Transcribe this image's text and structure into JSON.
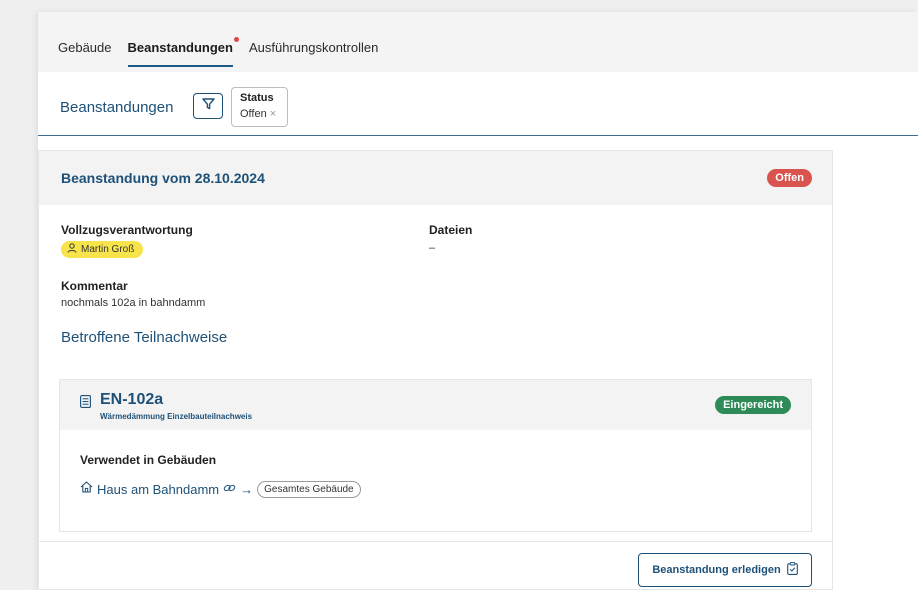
{
  "tabs": [
    {
      "label": "Gebäude",
      "active": false,
      "dot": false
    },
    {
      "label": "Beanstandungen",
      "active": true,
      "dot": true
    },
    {
      "label": "Ausführungskontrollen",
      "active": false,
      "dot": false
    }
  ],
  "filter": {
    "title": "Beanstandungen",
    "chip_label": "Status",
    "chip_value": "Offen",
    "chip_remove": "×"
  },
  "card": {
    "title": "Beanstandung vom 28.10.2024",
    "status": "Offen",
    "responsibility_label": "Vollzugsverantwortung",
    "responsible_person": "Martin Groß",
    "files_label": "Dateien",
    "files_value": "–",
    "comment_label": "Kommentar",
    "comment_value": "nochmals 102a in bahndamm",
    "affected_title": "Betroffene Teilnachweise",
    "proof": {
      "code": "EN-102a",
      "description": "Wärmedämmung Einzelbauteilnachweis",
      "status": "Eingereicht",
      "used_in_label": "Verwendet in Gebäuden",
      "building": "Haus am Bahndamm",
      "arrow": "→",
      "scope": "Gesamtes Gebäude"
    },
    "action_label": "Beanstandung erledigen"
  },
  "colors": {
    "accent": "#1e5178",
    "status_open": "#d9534f",
    "status_submitted": "#2e8a57",
    "person_chip": "#f7e34a"
  }
}
